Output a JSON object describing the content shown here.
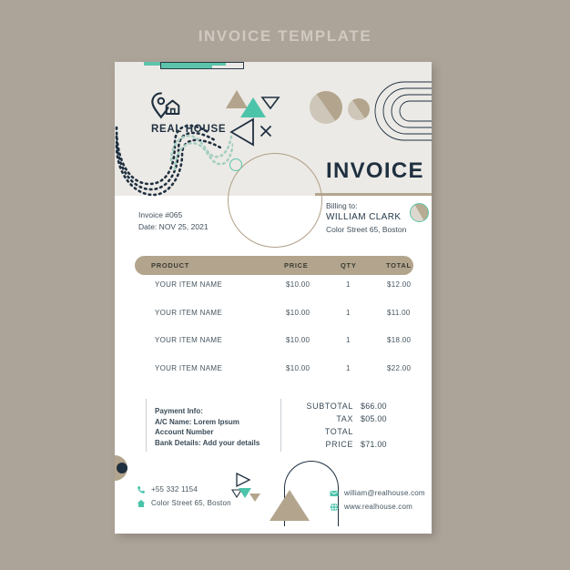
{
  "page": {
    "title": "INVOICE TEMPLATE",
    "background_color": "#ada499",
    "sheet_color": "#ffffff",
    "header_band_color": "#eceae6"
  },
  "colors": {
    "teal": "#5bc4aa",
    "tan": "#b3a58d",
    "navy": "#1f3040",
    "text": "#46555f"
  },
  "brand": {
    "name": "REAL HOUSE",
    "logo_icon": "location-pin-house-icon"
  },
  "document": {
    "heading": "INVOICE",
    "invoice_number": "Invoice #065",
    "date": "Date: NOV 25, 2021"
  },
  "billing": {
    "label": "Billing to:",
    "name": "WILLIAM CLARK",
    "address": "Color Street 65, Boston"
  },
  "table": {
    "columns": [
      "PRODUCT",
      "PRICE",
      "QTY",
      "TOTAL"
    ],
    "rows": [
      {
        "product": "YOUR ITEM NAME",
        "price": "$10.00",
        "qty": "1",
        "total": "$12.00"
      },
      {
        "product": "YOUR ITEM NAME",
        "price": "$10.00",
        "qty": "1",
        "total": "$11.00"
      },
      {
        "product": "YOUR ITEM NAME",
        "price": "$10.00",
        "qty": "1",
        "total": "$18.00"
      },
      {
        "product": "YOUR ITEM NAME",
        "price": "$10.00",
        "qty": "1",
        "total": "$22.00"
      }
    ]
  },
  "payment_info": {
    "line1": "Payment Info:",
    "line2": "A/C Name: Lorem Ipsum",
    "line3": "Account Number",
    "line4": "Bank Details: Add your details"
  },
  "totals": {
    "subtotal_label": "SUBTOTAL",
    "subtotal_value": "$66.00",
    "tax_label": "TAX",
    "tax_value": "$05.00",
    "total_label": "TOTAL",
    "price_label": "PRICE",
    "price_value": "$71.00"
  },
  "footer": {
    "phone": "+55 332 1154",
    "address": "Color Street 65, Boston",
    "email": "william@realhouse.com",
    "website": "www.realhouse.com",
    "phone_icon": "phone-icon",
    "address_icon": "home-icon",
    "email_icon": "envelope-icon",
    "website_icon": "globe-icon"
  }
}
